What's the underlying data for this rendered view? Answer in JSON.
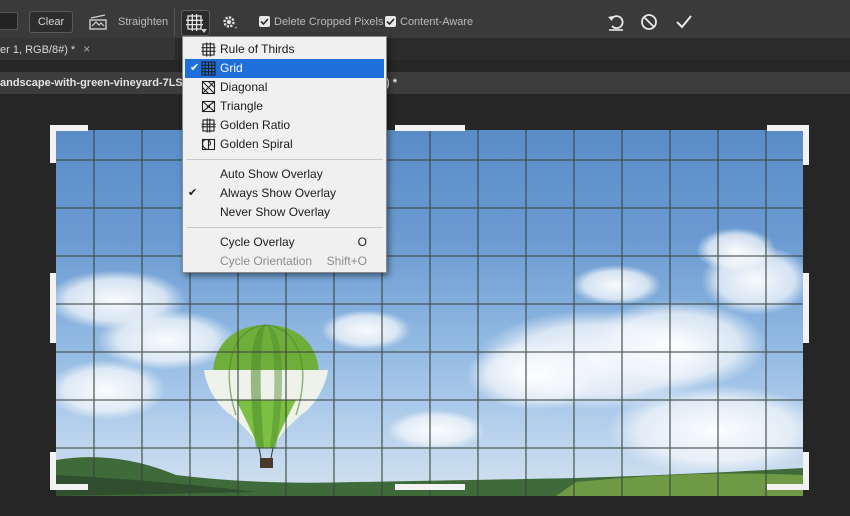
{
  "toolbar": {
    "clear_label": "Clear",
    "straighten_label": "Straighten",
    "delete_cropped_label": "Delete Cropped Pixels",
    "content_aware_label": "Content-Aware"
  },
  "tabs": [
    {
      "label": "er 1, RGB/8#) *",
      "close": "×"
    }
  ],
  "document": {
    "title_left": "andscape-with-green-vineyard-7LS",
    "title_right": ") *"
  },
  "overlay_menu": {
    "overlays": [
      {
        "label": "Rule of Thirds",
        "icon": "rule-of-thirds-icon",
        "checked": false
      },
      {
        "label": "Grid",
        "icon": "grid-icon",
        "checked": true
      },
      {
        "label": "Diagonal",
        "icon": "diagonal-icon",
        "checked": false
      },
      {
        "label": "Triangle",
        "icon": "triangle-icon",
        "checked": false
      },
      {
        "label": "Golden Ratio",
        "icon": "golden-ratio-icon",
        "checked": false
      },
      {
        "label": "Golden Spiral",
        "icon": "golden-spiral-icon",
        "checked": false
      }
    ],
    "show_modes": [
      {
        "label": "Auto Show Overlay",
        "checked": false
      },
      {
        "label": "Always Show Overlay",
        "checked": true
      },
      {
        "label": "Never Show Overlay",
        "checked": false
      }
    ],
    "cycle": [
      {
        "label": "Cycle Overlay",
        "shortcut": "O",
        "disabled": false
      },
      {
        "label": "Cycle Orientation",
        "shortcut": "Shift+O",
        "disabled": true
      }
    ]
  },
  "colors": {
    "menu_highlight": "#1e6fd9",
    "toolbar_bg": "#3a3a3a",
    "canvas_bg": "#262626"
  }
}
